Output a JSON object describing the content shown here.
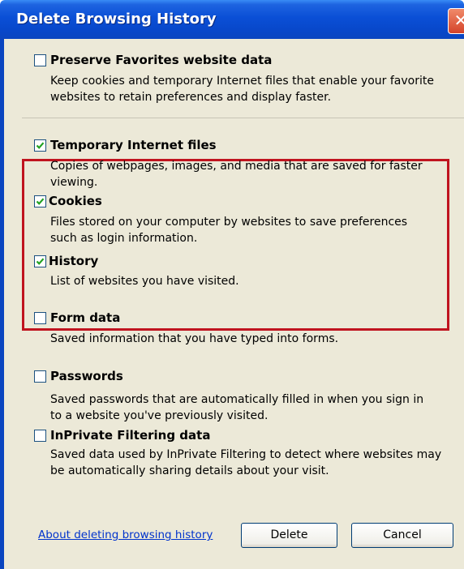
{
  "window": {
    "title": "Delete Browsing History",
    "close_glyph": "✕"
  },
  "options": [
    {
      "label": "Preserve Favorites website data",
      "checked": false,
      "desc1": "Keep cookies and temporary Internet files that enable your favorite",
      "desc2": "websites to retain preferences and display faster."
    },
    {
      "label": "Temporary Internet files",
      "checked": true,
      "desc1": "Copies of webpages, images, and media that are saved for faster",
      "desc2": "viewing."
    },
    {
      "label": "Cookies",
      "checked": true,
      "desc1": "Files stored on your computer by websites to save preferences",
      "desc2": "such as login information."
    },
    {
      "label": "History",
      "checked": true,
      "desc1": "List of websites you have visited.",
      "desc2": ""
    },
    {
      "label": "Form data",
      "checked": false,
      "desc1": "Saved information that you have typed into forms.",
      "desc2": ""
    },
    {
      "label": "Passwords",
      "checked": false,
      "desc1": "Saved passwords that are automatically filled in when you sign in",
      "desc2": "to a website you've previously visited."
    },
    {
      "label": "InPrivate Filtering data",
      "checked": false,
      "desc1": "Saved data used by InPrivate Filtering to detect where websites may",
      "desc2": "be automatically sharing details about your visit."
    }
  ],
  "footer": {
    "link": "About deleting browsing history",
    "delete_label": "Delete",
    "cancel_label": "Cancel"
  },
  "colors": {
    "titlebar": "#0a4fd6",
    "highlight_border": "#c0141f",
    "checkmark": "#21a121"
  }
}
